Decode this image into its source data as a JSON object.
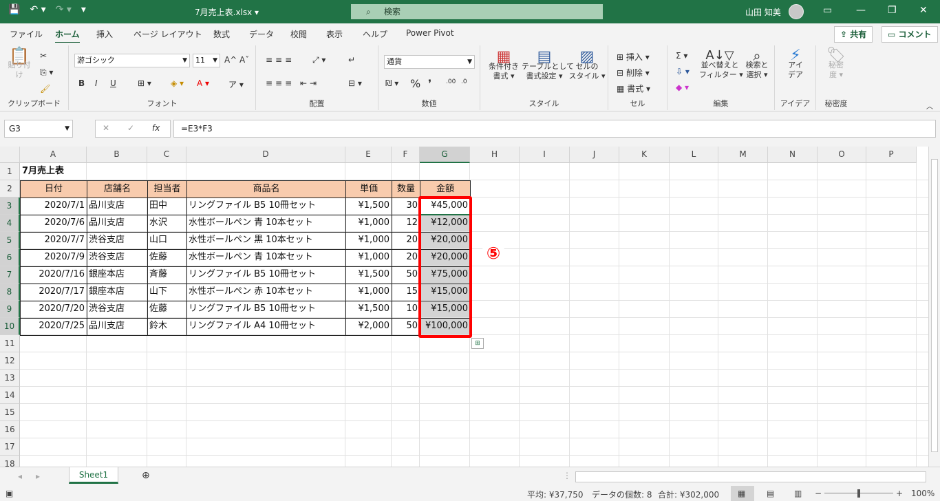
{
  "titlebar": {
    "filename": "7月売上表.xlsx ▾",
    "search_placeholder": "検索",
    "user": "山田 知美",
    "save_icon": "💾",
    "undo_icon": "↶ ▾",
    "redo_icon": "↷ ▾",
    "qat_more": "▾",
    "ribbon_display": "▭",
    "minimize": "—",
    "restore": "❐",
    "close": "✕"
  },
  "tabs": [
    "ファイル",
    "ホーム",
    "挿入",
    "ページ レイアウト",
    "数式",
    "データ",
    "校閲",
    "表示",
    "ヘルプ",
    "Power Pivot"
  ],
  "share_label": "共有",
  "comment_label": "コメント",
  "ribbon": {
    "clipboard": {
      "paste": "貼り付け",
      "label": "クリップボード"
    },
    "font": {
      "name": "游ゴシック",
      "size": "11",
      "label": "フォント",
      "bold": "B",
      "italic": "I",
      "underline": "U",
      "grow": "A^",
      "shrink": "Aˇ"
    },
    "alignment": {
      "label": "配置"
    },
    "number": {
      "format": "通貨",
      "label": "数値",
      "percent": "%",
      "comma": "❜"
    },
    "styles": {
      "cond": "条件付き\n書式 ▾",
      "table": "テーブルとして\n書式設定 ▾",
      "cell": "セルの\nスタイル ▾",
      "label": "スタイル"
    },
    "cells": {
      "insert": "挿入",
      "delete": "削除",
      "format": "書式",
      "label": "セル"
    },
    "editing": {
      "sort": "並べ替えと\nフィルター ▾",
      "find": "検索と\n選択 ▾",
      "label": "編集"
    },
    "ideas": {
      "btn": "アイ\nデア",
      "label": "アイデア"
    },
    "sensitivity": {
      "btn": "秘密\n度 ▾",
      "label": "秘密度"
    }
  },
  "formula_bar": {
    "namebox": "G3",
    "formula": "=E3*F3",
    "fx": "fx"
  },
  "columns": [
    "A",
    "B",
    "C",
    "D",
    "E",
    "F",
    "G",
    "H",
    "I",
    "J",
    "K",
    "L",
    "M",
    "N",
    "O",
    "P"
  ],
  "rows": [
    "1",
    "2",
    "3",
    "4",
    "5",
    "6",
    "7",
    "8",
    "9",
    "10",
    "11",
    "12",
    "13",
    "14",
    "15",
    "16",
    "17",
    "18"
  ],
  "sheet": {
    "title": "7月売上表",
    "headers": [
      "日付",
      "店舗名",
      "担当者",
      "商品名",
      "単価",
      "数量",
      "金額"
    ],
    "data": [
      [
        "2020/7/1",
        "品川支店",
        "田中",
        "リングファイル B5 10冊セット",
        "¥1,500",
        "30",
        "¥45,000"
      ],
      [
        "2020/7/6",
        "品川支店",
        "水沢",
        "水性ボールペン 青 10本セット",
        "¥1,000",
        "12",
        "¥12,000"
      ],
      [
        "2020/7/7",
        "渋谷支店",
        "山口",
        "水性ボールペン 黒 10本セット",
        "¥1,000",
        "20",
        "¥20,000"
      ],
      [
        "2020/7/9",
        "渋谷支店",
        "佐藤",
        "水性ボールペン 青 10本セット",
        "¥1,000",
        "20",
        "¥20,000"
      ],
      [
        "2020/7/16",
        "銀座本店",
        "斉藤",
        "リングファイル B5 10冊セット",
        "¥1,500",
        "50",
        "¥75,000"
      ],
      [
        "2020/7/17",
        "銀座本店",
        "山下",
        "水性ボールペン 赤 10本セット",
        "¥1,000",
        "15",
        "¥15,000"
      ],
      [
        "2020/7/20",
        "渋谷支店",
        "佐藤",
        "リングファイル B5 10冊セット",
        "¥1,500",
        "10",
        "¥15,000"
      ],
      [
        "2020/7/25",
        "品川支店",
        "鈴木",
        "リングファイル A4 10冊セット",
        "¥2,000",
        "50",
        "¥100,000"
      ]
    ]
  },
  "annotation": "⑤",
  "sheet_tab": "Sheet1",
  "status": {
    "average": "平均: ¥37,750",
    "count": "データの個数: 8",
    "sum": "合計: ¥302,000",
    "zoom": "100%"
  }
}
